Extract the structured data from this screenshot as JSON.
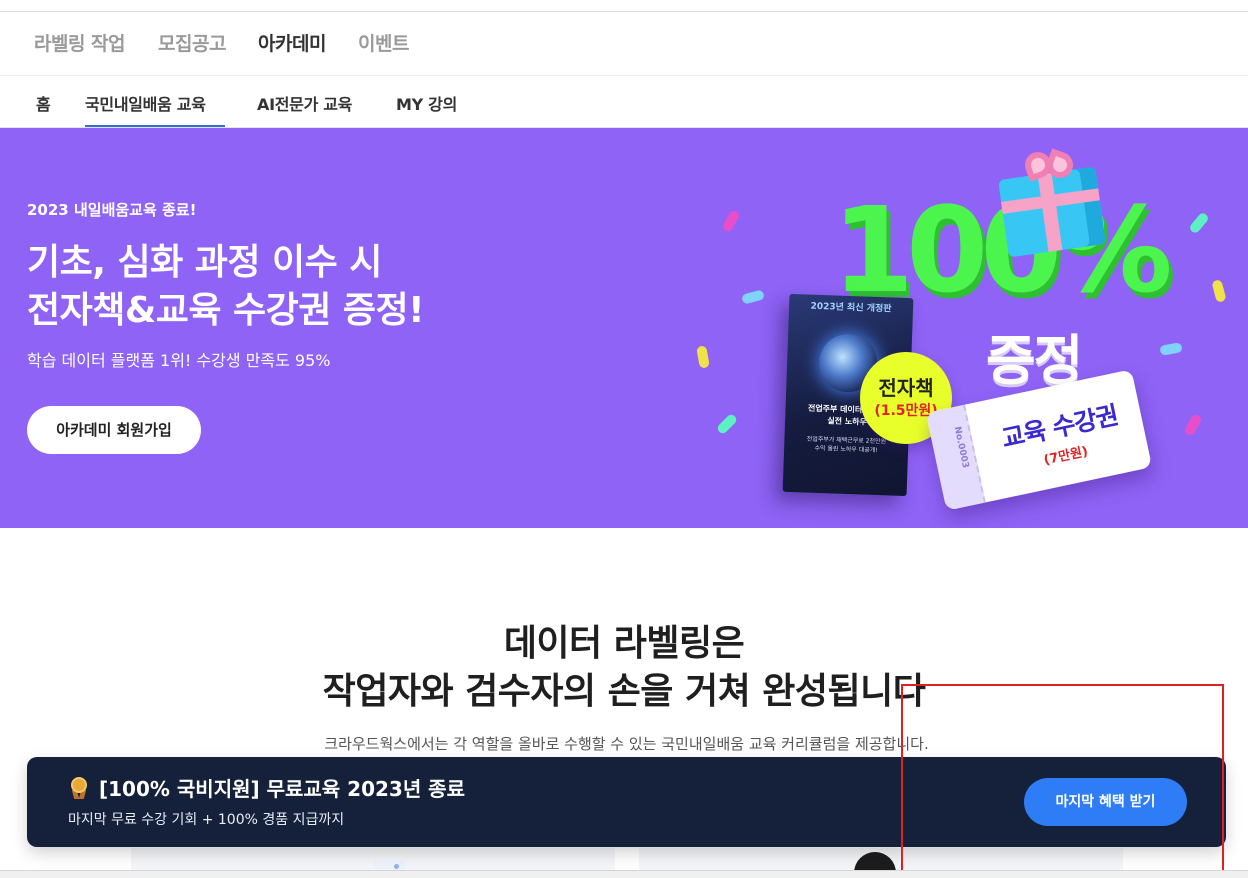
{
  "gnb": {
    "items": [
      "라벨링 작업",
      "모집공고",
      "아카데미",
      "이벤트"
    ],
    "active_index": 2
  },
  "lnb": {
    "items": [
      "홈",
      "국민내일배움 교육",
      "AI전문가 교육",
      "MY 강의"
    ],
    "active_index": 1
  },
  "hero": {
    "eyebrow": "2023 내일배움교육 종료!",
    "title_line1": "기초, 심화 과정 이수 시",
    "title_line2": "전자책&교육 수강권 증정!",
    "subtitle": "학습 데이터 플랫폼 1위! 수강생 만족도 95%",
    "cta_label": "아카데미 회원가입",
    "promo": {
      "big_text": "100%",
      "word": "증정",
      "book_top": "2023년 최신 개정판",
      "book_title_line1": "전업주부 데이터 라벨링",
      "book_title_line2": "실전 노하우",
      "book_desc_line1": "전업주부가 재택근무로 2천만원",
      "book_desc_line2": "수익 올린 노하우 대공개!",
      "ebook_label": "전자책",
      "ebook_price": "(1.5만원)",
      "ticket_label": "교육 수강권",
      "ticket_price": "(7만원)",
      "ticket_code": "No.0003"
    },
    "bg_color": "#8e63f6"
  },
  "section": {
    "title_line1": "데이터 라벨링은",
    "title_line2": "작업자와 검수자의 손을 거쳐 완성됩니다",
    "description": "크라우드웍스에서는 각 역할을 올바로 수행할 수 있는 국민내일배움 교육 커리큘럼을 제공합니다."
  },
  "banner": {
    "icon": "medal-icon",
    "title": "[100% 국비지원] 무료교육 2023년 종료",
    "subtitle": "마지막 무료 수강 기회 + 100% 경품 지급까지",
    "cta_label": "마지막 혜택 받기",
    "bg_color": "#15203a",
    "cta_color": "#2f7df6"
  }
}
